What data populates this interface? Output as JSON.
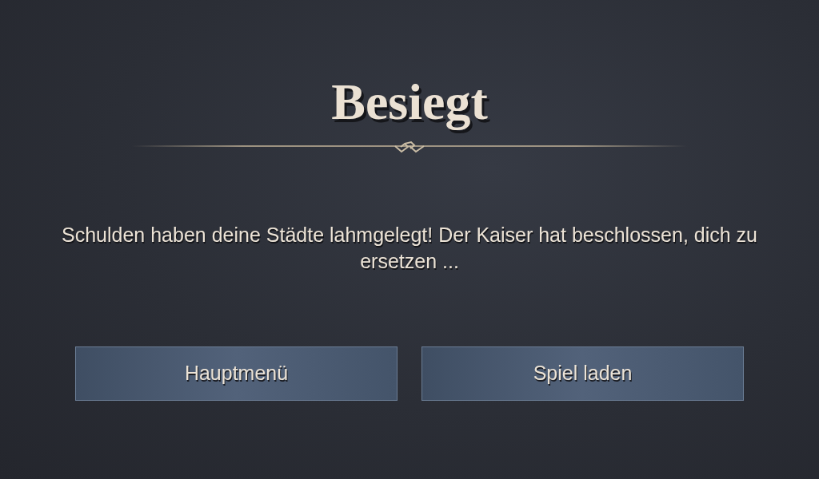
{
  "dialog": {
    "title": "Besiegt",
    "message": "Schulden haben deine Städte lahmgelegt! Der Kaiser hat beschlossen, dich zu ersetzen ...",
    "buttons": [
      {
        "label": "Hauptmenü"
      },
      {
        "label": "Spiel laden"
      }
    ]
  }
}
